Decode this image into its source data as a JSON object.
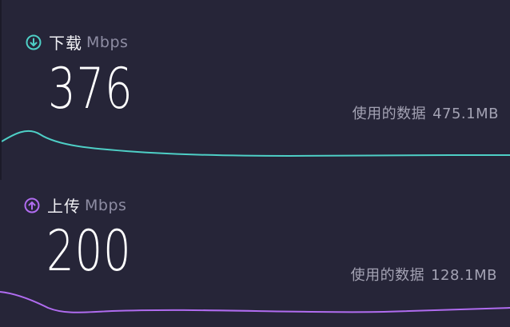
{
  "download": {
    "label": "下载",
    "unit": "Mbps",
    "value": "376",
    "usage_label": "使用的数据",
    "usage_value": "475.1MB",
    "color": "#4ecfc6",
    "icon": "arrow-down-circle-icon"
  },
  "upload": {
    "label": "上传",
    "unit": "Mbps",
    "value": "200",
    "usage_label": "使用的数据",
    "usage_value": "128.1MB",
    "color": "#b06cf0",
    "icon": "arrow-up-circle-icon"
  }
}
